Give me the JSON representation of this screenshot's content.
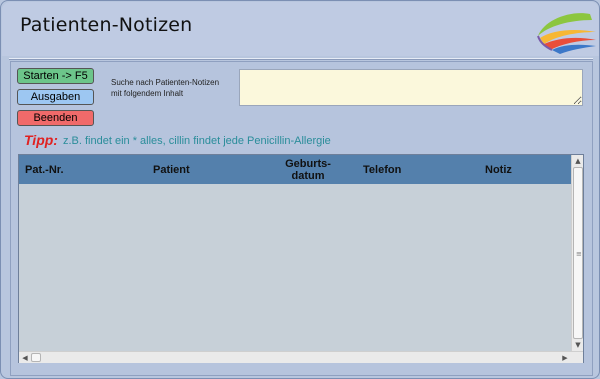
{
  "window": {
    "title": "Patienten-Notizen"
  },
  "buttons": {
    "start_label": "Starten -> F5",
    "ausgaben_label": "Ausgaben",
    "beenden_label": "Beenden"
  },
  "search": {
    "label_line1": "Suche nach Patienten-Notizen",
    "label_line2": "mit folgendem Inhalt",
    "value": ""
  },
  "tip": {
    "key": "Tipp:",
    "text": "z.B. findet ein * alles, cillin findet jede Penicillin-Allergie"
  },
  "table": {
    "columns": [
      "Pat.-Nr.",
      "Patient",
      "Geburts-",
      "datum",
      "Telefon",
      "Notiz"
    ],
    "rows": []
  },
  "icons": {
    "logo": "brand-swoosh-logo",
    "scroll_up": "chevron-up-icon",
    "scroll_down": "chevron-down-icon",
    "scroll_left": "chevron-left-icon",
    "scroll_right": "chevron-right-icon"
  },
  "colors": {
    "start_button": "#6cc58a",
    "ausgaben_button": "#9dc7f2",
    "beenden_button": "#f06a6a",
    "header_bar": "#5480ac",
    "search_field": "#fbf8dc",
    "tip_key": "#e02222",
    "tip_text": "#2a8d9a"
  }
}
